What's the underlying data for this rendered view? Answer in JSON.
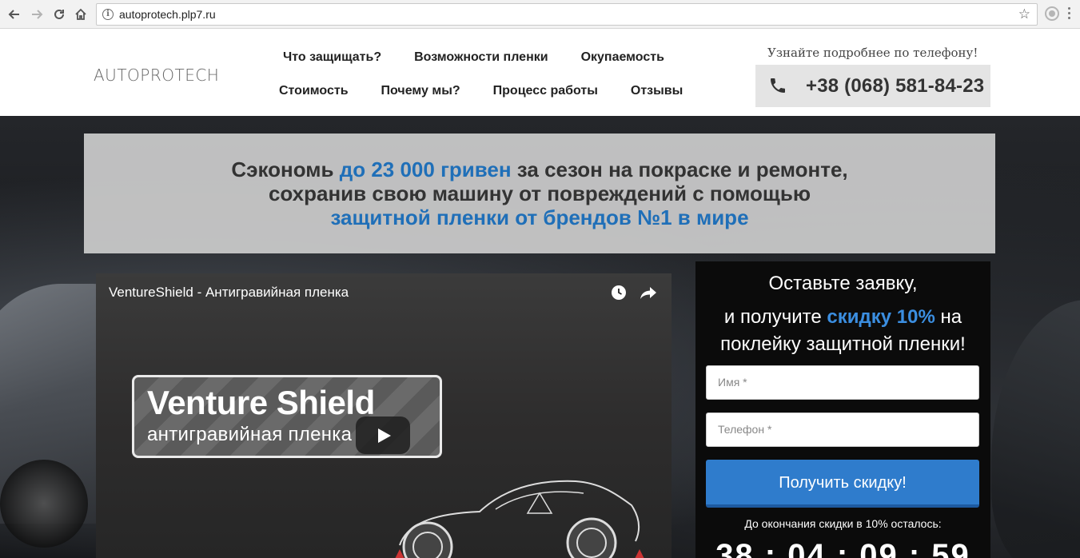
{
  "browser": {
    "url": "autoprotech.plp7.ru"
  },
  "header": {
    "logo": "AUTOPROTECH",
    "menu_row1": [
      "Что защищать?",
      "Возможности пленки",
      "Окупаемость"
    ],
    "menu_row2": [
      "Стоимость",
      "Почему мы?",
      "Процесс работы",
      "Отзывы"
    ],
    "phone_caption": "Узнайте подробнее по телефону!",
    "phone_number": "+38 (068) 581-84-23"
  },
  "banner": {
    "line1_a": "Сэкономь ",
    "line1_b": "до 23 000 гривен",
    "line1_c": " за сезон на покраске и ремонте,",
    "line2": "сохранив свою машину от повреждений с помощью",
    "line3": "защитной пленки от брендов №1 в мире"
  },
  "video": {
    "title": "VentureShield - Антигравийная пленка",
    "card_title": "Venture Shield",
    "card_subtitle": "антигравийная пленка"
  },
  "form": {
    "heading1": "Оставьте заявку,",
    "heading2_a": "и получите ",
    "heading2_b": "скидку 10%",
    "heading2_c": " на",
    "heading3": "поклейку защитной пленки!",
    "name_placeholder": "Имя *",
    "phone_placeholder": "Телефон *",
    "submit_label": "Получить скидку!",
    "countdown_label": "До окончания скидки в 10% осталось:",
    "countdown_value": "38 : 04 : 09 : 59"
  },
  "colors": {
    "accent_blue": "#1f6fb8",
    "button_blue": "#2f7ccc"
  }
}
